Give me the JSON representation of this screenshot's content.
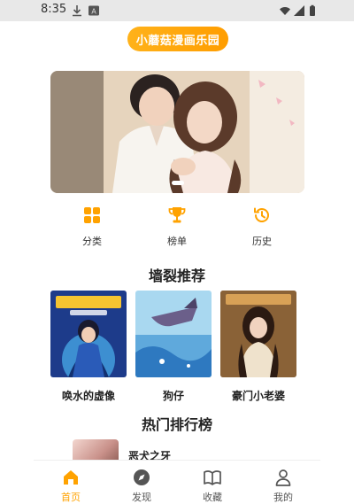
{
  "status_bar": {
    "time": "8:35"
  },
  "header": {
    "title": "小蘑菇漫画乐园"
  },
  "categories": [
    {
      "label": "分类",
      "icon": "grid-icon"
    },
    {
      "label": "榜单",
      "icon": "trophy-icon"
    },
    {
      "label": "历史",
      "icon": "history-icon"
    }
  ],
  "recommend": {
    "title": "墙裂推荐",
    "items": [
      {
        "name": "唤水的虚像"
      },
      {
        "name": "狗仔"
      },
      {
        "name": "豪门小老婆"
      }
    ]
  },
  "ranking": {
    "title": "热门排行榜",
    "items": [
      {
        "name": "恶犬之牙"
      }
    ]
  },
  "bottom_nav": [
    {
      "label": "首页",
      "icon": "home-icon",
      "active": true
    },
    {
      "label": "发现",
      "icon": "compass-icon",
      "active": false
    },
    {
      "label": "收藏",
      "icon": "book-icon",
      "active": false
    },
    {
      "label": "我的",
      "icon": "user-icon",
      "active": false
    }
  ],
  "colors": {
    "accent": "#ffa200",
    "nav_inactive": "#555555"
  }
}
